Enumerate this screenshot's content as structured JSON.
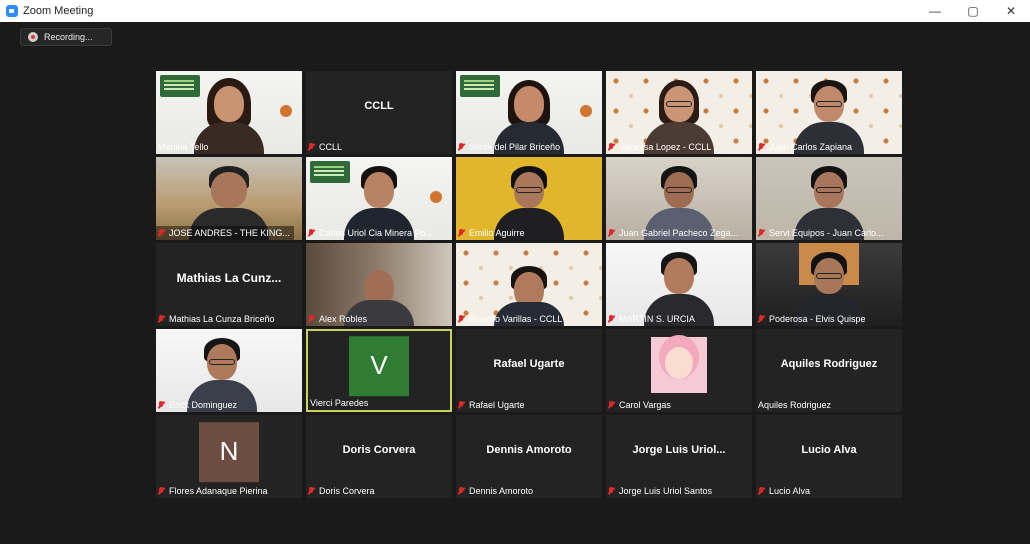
{
  "window": {
    "title": "Zoom Meeting",
    "minimize": "—",
    "restore": "▢",
    "close": "✕"
  },
  "recording": {
    "label": "Recording..."
  },
  "participants": [
    {
      "label": "Mariela Tello"
    },
    {
      "label": "CCLL",
      "center": "CCLL"
    },
    {
      "label": "Sonia del Pilar Briceño"
    },
    {
      "label": "Vanessa Lopez - CCLL"
    },
    {
      "label": "Juan Carlos Zapiana"
    },
    {
      "label": "JOSE ANDRES - THE KING..."
    },
    {
      "label": "Carlos Uriol Cia Minera Po..."
    },
    {
      "label": "Emilio Aguirre"
    },
    {
      "label": "Juan Gabriel Pacheco Zega..."
    },
    {
      "label": "Servi Equipos - Juan Carlo..."
    },
    {
      "label": "Mathias La Cunza Briceño",
      "center": "Mathias La Cunz..."
    },
    {
      "label": "Alex Robles"
    },
    {
      "label": "Ricardo Varillas - CCLL"
    },
    {
      "label": "MARTIN S. URCIA"
    },
    {
      "label": "Poderosa - Elvis Quispe"
    },
    {
      "label": "Erick Dominguez"
    },
    {
      "label": "Vierci Paredes",
      "avatar": "V"
    },
    {
      "label": "Rafael Ugarte",
      "center": "Rafael Ugarte"
    },
    {
      "label": "Carol Vargas"
    },
    {
      "label": "Aquiles Rodriguez",
      "center": "Aquiles Rodriguez"
    },
    {
      "label": "Flores Adanaque Pierina",
      "avatar": "N"
    },
    {
      "label": "Doris Corvera",
      "center": "Doris Corvera"
    },
    {
      "label": "Dennis Amoroto",
      "center": "Dennis Amoroto"
    },
    {
      "label": "Jorge Luis Uriol Santos",
      "center": "Jorge Luis Uriol..."
    },
    {
      "label": "Lucio Alva",
      "center": "Lucio Alva"
    }
  ],
  "colors": {
    "accent_active": "#c8d35c",
    "mic_muted": "#e02828",
    "avatar_v": "#2e7d32",
    "avatar_n": "#6d4c41"
  }
}
